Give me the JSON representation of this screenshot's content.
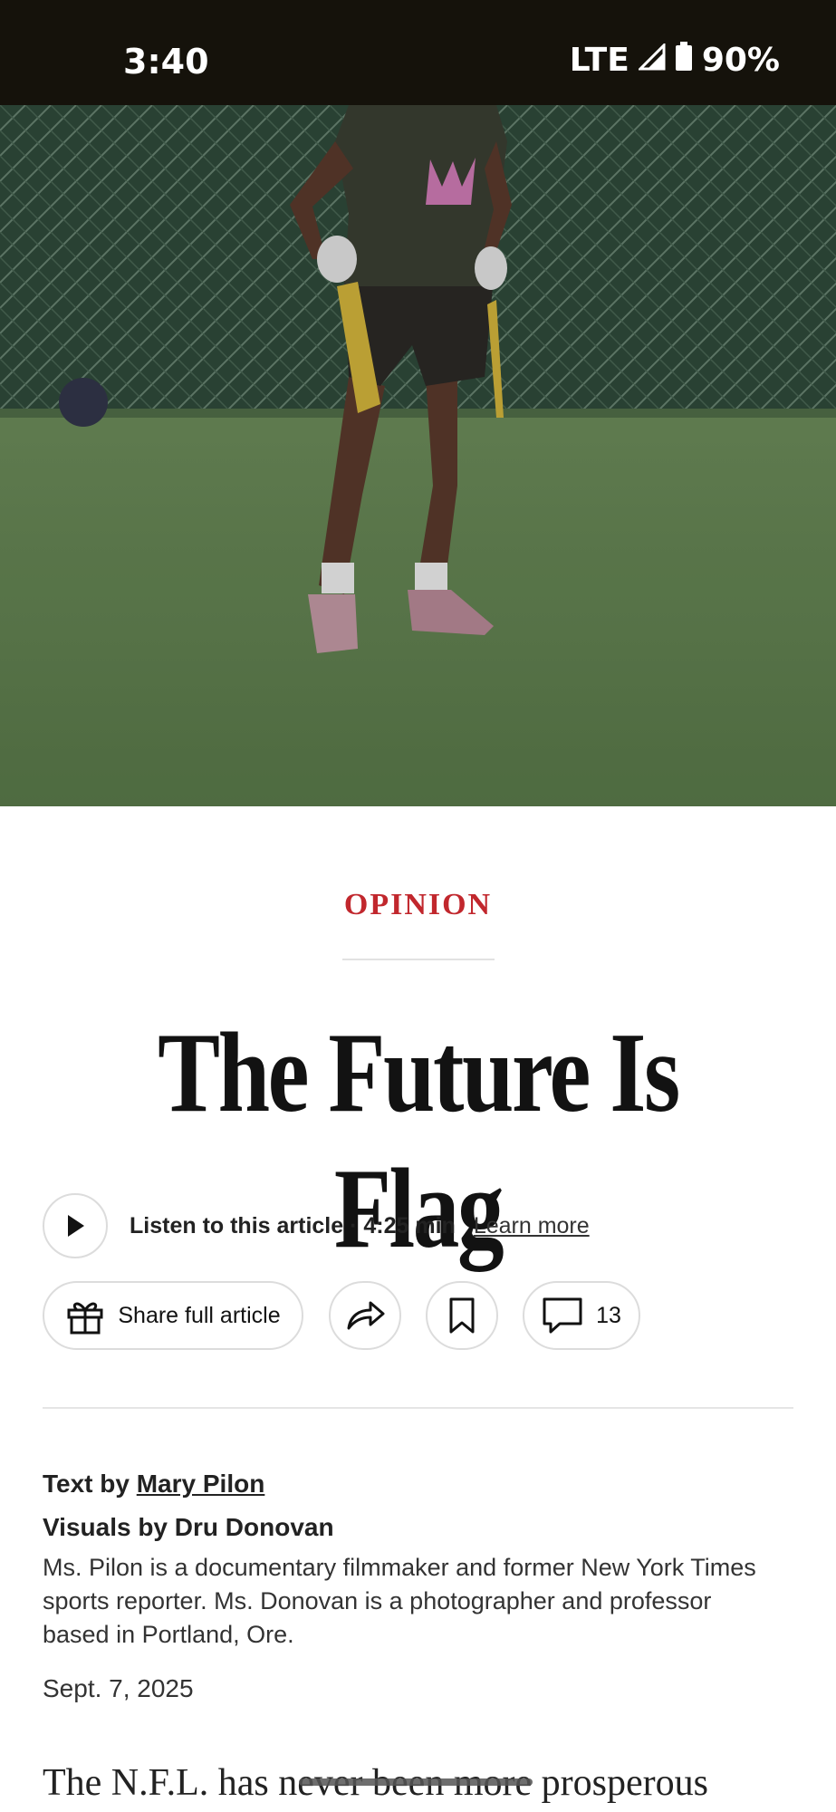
{
  "status_bar": {
    "time": "3:40",
    "network": "LTE",
    "battery": "90%"
  },
  "hero": {
    "icon": "hero-photo-flag-football-player"
  },
  "article": {
    "kicker": "OPINION",
    "headline": "The Future Is Flag",
    "listen": {
      "label": "Listen to this article · 4:25 min",
      "learn_more": "Learn more"
    },
    "actions": {
      "share_full_article": "Share full article",
      "comment_count": "13"
    },
    "byline": {
      "text_by_prefix": "Text by ",
      "author": "Mary Pilon",
      "visuals_by": "Visuals by Dru Donovan",
      "bio": "Ms. Pilon is a documentary filmmaker and former New York Times sports reporter. Ms. Donovan is a photographer and professor based in Portland, Ore."
    },
    "date": "Sept. 7, 2025",
    "body_first_line": "The N.F.L. has never been more prosperous"
  },
  "colors": {
    "kicker_red": "#c1272d",
    "status_bar_bg": "#15120b"
  }
}
